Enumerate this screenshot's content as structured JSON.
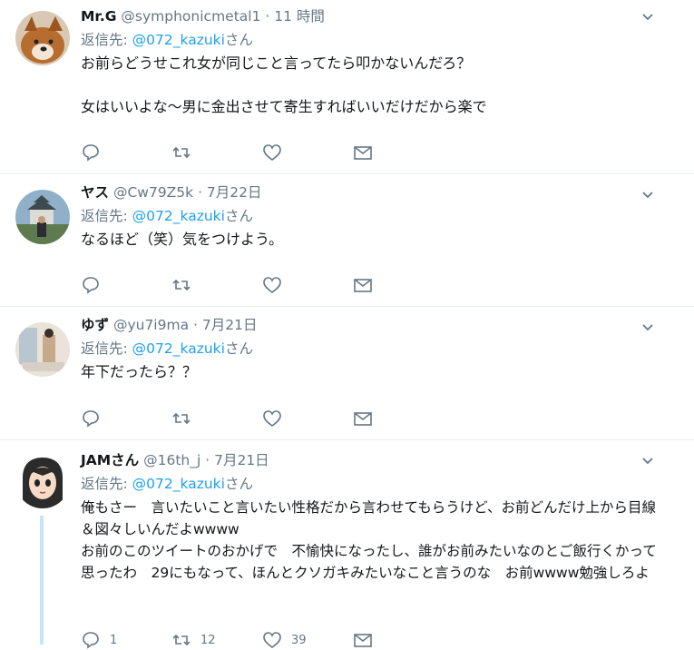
{
  "tweets": [
    {
      "name": "Mr.G",
      "handle": "@symphonicmetal1",
      "time": "11 時間",
      "replying_label": "返信先: ",
      "replying_to": "@072_kazuki",
      "replying_suffix": "さん",
      "lines": [
        "お前らどうせこれ女が同じこと言ってたら叩かないんだろ？",
        "",
        "女はいいよな〜男に金出させて寄生すればいいだけだから楽で"
      ],
      "counts": {
        "reply": "",
        "retweet": "",
        "like": ""
      }
    },
    {
      "name": "ヤス",
      "handle": "@Cw79Z5k",
      "time": "7月22日",
      "replying_label": "返信先: ",
      "replying_to": "@072_kazuki",
      "replying_suffix": "さん",
      "lines": [
        "なるほど（笑）気をつけよう。"
      ],
      "counts": {
        "reply": "",
        "retweet": "",
        "like": ""
      }
    },
    {
      "name": "ゆず",
      "handle": "@yu7i9ma",
      "time": "7月21日",
      "replying_label": "返信先: ",
      "replying_to": "@072_kazuki",
      "replying_suffix": "さん",
      "lines": [
        "年下だったら？？"
      ],
      "counts": {
        "reply": "",
        "retweet": "",
        "like": ""
      }
    },
    {
      "name": "JAMさん",
      "handle": "@16th_j",
      "time": "7月21日",
      "replying_label": "返信先: ",
      "replying_to": "@072_kazuki",
      "replying_suffix": "さん",
      "lines": [
        "俺もさー　言いたいこと言いたい性格だから言わせてもらうけど、お前どんだけ上から目線＆図々しいんだよwwww",
        "お前のこのツイートのおかげで　不愉快になったし、誰がお前みたいなのとご飯行くかって思ったわ　29にもなって、ほんとクソガキみたいなこと言うのな　お前wwww勉強しろよ"
      ],
      "counts": {
        "reply": "1",
        "retweet": "12",
        "like": "39"
      }
    }
  ],
  "separator": " · ",
  "colors": {
    "accent": "#1da1f2",
    "muted": "#657786",
    "text": "#14171a",
    "thread": "#c4e5f8"
  }
}
